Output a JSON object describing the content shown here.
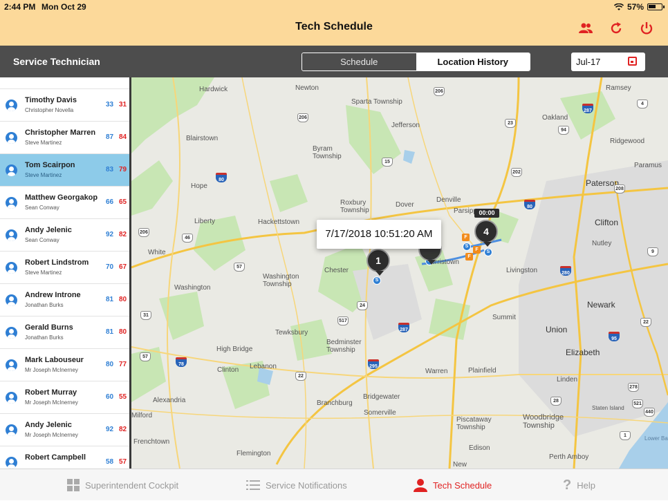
{
  "status": {
    "time": "2:44 PM",
    "date": "Mon Oct 29",
    "battery": "57%"
  },
  "header": {
    "title": "Tech Schedule"
  },
  "toolbar": {
    "label": "Service Technician",
    "tabs": [
      {
        "label": "Schedule"
      },
      {
        "label": "Location History"
      }
    ],
    "date": "Jul-17"
  },
  "technicians": [
    {
      "name": "Timothy Davis",
      "sub": "Christopher Novella",
      "blue": "33",
      "red": "31"
    },
    {
      "name": "Christopher Marren",
      "sub": "Steve Martinez",
      "blue": "87",
      "red": "84"
    },
    {
      "name": "Tom Scairpon",
      "sub": "Steve Martinez",
      "blue": "83",
      "red": "79"
    },
    {
      "name": "Matthew Georgakop",
      "sub": "Sean Conway",
      "blue": "66",
      "red": "65"
    },
    {
      "name": "Andy Jelenic",
      "sub": "Sean Conway",
      "blue": "92",
      "red": "82"
    },
    {
      "name": "Robert Lindstrom",
      "sub": "Steve Martinez",
      "blue": "70",
      "red": "67"
    },
    {
      "name": "Andrew Introne",
      "sub": "Jonathan Burks",
      "blue": "81",
      "red": "80"
    },
    {
      "name": "Gerald Burns",
      "sub": "Jonathan Burks",
      "blue": "81",
      "red": "80"
    },
    {
      "name": "Mark Labouseur",
      "sub": "Mr Joseph McInerney",
      "blue": "80",
      "red": "77"
    },
    {
      "name": "Robert Murray",
      "sub": "Mr Joseph McInerney",
      "blue": "60",
      "red": "55"
    },
    {
      "name": "Andy Jelenic",
      "sub": "Mr Joseph McInerney",
      "blue": "92",
      "red": "82"
    },
    {
      "name": "Robert Campbell",
      "sub": "",
      "blue": "58",
      "red": "57"
    }
  ],
  "map": {
    "tooltip": "7/17/2018 10:51:20 AM",
    "time_badge": "00:00",
    "pins": [
      "1",
      "4"
    ],
    "stop_marker": "S",
    "finish_marker": "F",
    "places": [
      "Hardwick",
      "Newton",
      "Sparta Township",
      "Ramsey",
      "Jefferson",
      "Oakland",
      "Blairstown",
      "Byram Township",
      "Ridgewood",
      "Paramus",
      "Hope",
      "Denville",
      "Paterson",
      "Dover",
      "Roxbury Township",
      "Parsippany",
      "Liberty",
      "Hackettstown",
      "Clifton",
      "Nutley",
      "White",
      "Chester",
      "Morristown",
      "Livingston",
      "Washington Township",
      "Washington",
      "Newark",
      "Summit",
      "Tewksbury",
      "Union",
      "Bedminster Township",
      "High Bridge",
      "Elizabeth",
      "Clinton",
      "Lebanon",
      "Warren",
      "Plainfield",
      "Linden",
      "Alexandria",
      "Branchburg",
      "Bridgewater",
      "Somerville",
      "Staten Island",
      "Piscataway Township",
      "Woodbridge Township",
      "Milford",
      "Frenchtown",
      "Flemington",
      "Edison",
      "Perth Amboy",
      "Lower Bay",
      "New"
    ],
    "shields": [
      "206",
      "23",
      "287",
      "15",
      "94",
      "46",
      "57",
      "24",
      "202",
      "206",
      "22",
      "517",
      "31",
      "80",
      "280",
      "57",
      "22",
      "28",
      "78",
      "95",
      "9",
      "278",
      "440",
      "1",
      "206",
      "287",
      "208",
      "4",
      "295",
      "80",
      "521"
    ]
  },
  "tabbar": {
    "tabs": [
      {
        "label": "Superintendent Cockpit"
      },
      {
        "label": "Service Notifications"
      },
      {
        "label": "Tech Schedule"
      },
      {
        "label": "Help"
      }
    ]
  },
  "colors": {
    "header": "#fcd99a",
    "toolbar": "#4d4d4d",
    "accent": "#e02222",
    "selected_row": "#8dcbe9",
    "badge_blue": "#2f7fd4"
  }
}
